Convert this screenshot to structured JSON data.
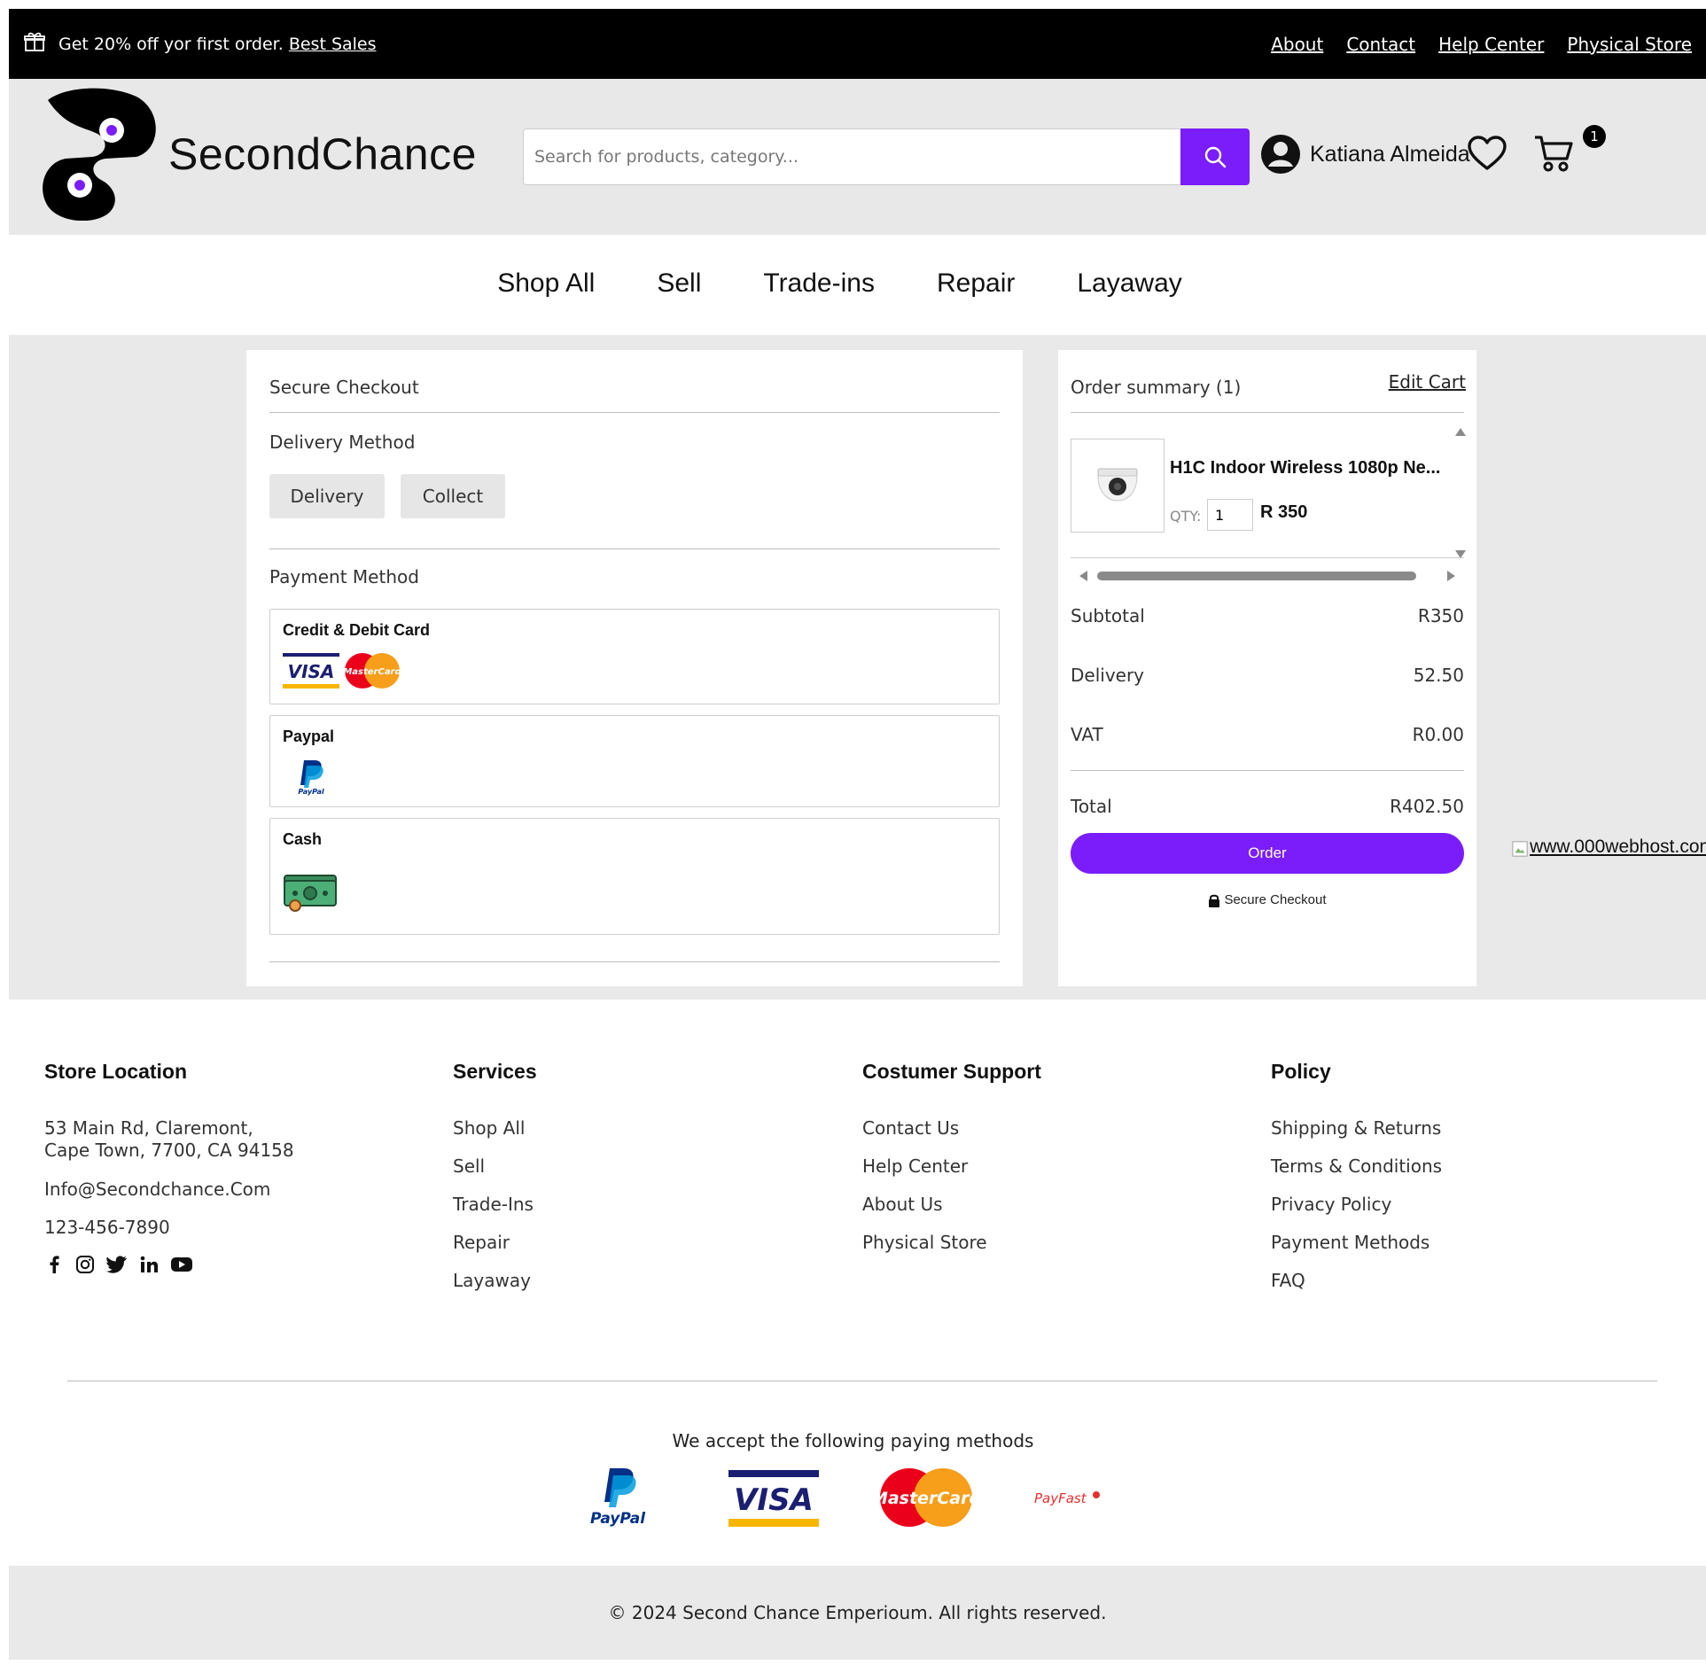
{
  "promo": {
    "text": "Get 20% off yor first order.",
    "link": "Best Sales",
    "links": [
      "About",
      "Contact",
      "Help Center",
      "Physical Store"
    ]
  },
  "header": {
    "brand": "SecondChance",
    "search_placeholder": "Search for products, category...",
    "user_name": "Katiana Almeida",
    "cart_count": "1",
    "accent_color": "#7a1dfa"
  },
  "nav": [
    "Shop All",
    "Sell",
    "Trade-ins",
    "Repair",
    "Layaway"
  ],
  "checkout": {
    "title": "Secure Checkout",
    "delivery_label": "Delivery Method",
    "delivery_options": [
      "Delivery",
      "Collect"
    ],
    "payment_label": "Payment Method",
    "payment_options": [
      {
        "title": "Credit & Debit Card",
        "icons": [
          "visa-icon",
          "mastercard-icon"
        ]
      },
      {
        "title": "Paypal",
        "icons": [
          "paypal-icon"
        ]
      },
      {
        "title": "Cash",
        "icons": [
          "cash-icon"
        ]
      }
    ]
  },
  "summary": {
    "title": "Order summary (1)",
    "edit_cart": "Edit Cart",
    "item": {
      "name": "H1C Indoor Wireless 1080p Ne...",
      "qty_label": "QTY:",
      "qty": "1",
      "price": "R 350"
    },
    "rows": [
      {
        "label": "Subtotal",
        "value": "R350"
      },
      {
        "label": "Delivery",
        "value": "52.50"
      },
      {
        "label": "VAT",
        "value": "R0.00"
      },
      {
        "label": "Total",
        "value": "R402.50"
      }
    ],
    "order_button": "Order",
    "secure_note": "Secure Checkout"
  },
  "broken_image_alt": "www.000webhost.com",
  "footer": {
    "store": {
      "title": "Store Location",
      "address_line1": "53 Main Rd, Claremont,",
      "address_line2": "Cape Town, 7700, CA 94158",
      "email": "Info@Secondchance.Com",
      "phone": "123-456-7890",
      "socials": [
        "facebook-icon",
        "instagram-icon",
        "twitter-icon",
        "linkedin-icon",
        "youtube-icon"
      ]
    },
    "services": {
      "title": "Services",
      "items": [
        "Shop All",
        "Sell",
        "Trade-Ins",
        "Repair",
        "Layaway"
      ]
    },
    "support": {
      "title": "Costumer Support",
      "items": [
        "Contact Us",
        "Help Center",
        "About Us",
        "Physical Store"
      ]
    },
    "policy": {
      "title": "Policy",
      "items": [
        "Shipping & Returns",
        "Terms & Conditions",
        "Privacy Policy",
        "Payment Methods",
        "FAQ"
      ]
    },
    "accept_text": "We accept the following paying methods",
    "payment_logos": [
      "paypal-logo",
      "visa-logo",
      "mastercard-logo",
      "payfast-logo"
    ],
    "logo_text": {
      "paypal": "PayPal",
      "visa": "VISA",
      "mastercard": "MasterCard",
      "payfast": "PayFast"
    },
    "copyright": "© 2024 Second Chance Emperioum. All rights reserved."
  }
}
